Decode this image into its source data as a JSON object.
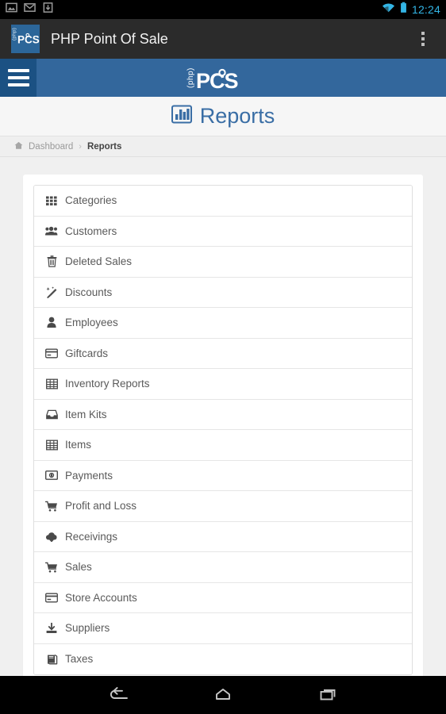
{
  "statusbar": {
    "icons": [
      "gallery-icon",
      "gmail-icon",
      "download-icon"
    ],
    "wifi_icon": "wifi-icon",
    "battery_icon": "battery-icon",
    "clock": "12:24",
    "accent_color": "#33b5e5"
  },
  "appbar": {
    "logo_text": "PCS",
    "logo_sub": "php",
    "title": "PHP Point Of Sale",
    "overflow_label": "More options",
    "background": "#2b2b2b",
    "logo_background": "#2c6699"
  },
  "navbar": {
    "menu_label": "Menu",
    "logo_main": "PCS",
    "logo_prefix": "(php)",
    "background": "#33679c",
    "menu_background": "#1b5183"
  },
  "page": {
    "title": "Reports",
    "title_icon": "bar-chart-icon",
    "title_color": "#3a6ea5"
  },
  "breadcrumb": {
    "home_icon": "home-icon",
    "items": [
      {
        "label": "Dashboard",
        "current": false
      },
      {
        "label": "Reports",
        "current": true
      }
    ],
    "separator": "›"
  },
  "reports": {
    "items": [
      {
        "label": "Categories",
        "icon": "grid-icon"
      },
      {
        "label": "Customers",
        "icon": "users-icon"
      },
      {
        "label": "Deleted Sales",
        "icon": "trash-icon"
      },
      {
        "label": "Discounts",
        "icon": "magic-wand-icon"
      },
      {
        "label": "Employees",
        "icon": "user-icon"
      },
      {
        "label": "Giftcards",
        "icon": "credit-card-icon"
      },
      {
        "label": "Inventory Reports",
        "icon": "table-icon"
      },
      {
        "label": "Item Kits",
        "icon": "inbox-icon"
      },
      {
        "label": "Items",
        "icon": "table-icon"
      },
      {
        "label": "Payments",
        "icon": "money-bill-icon"
      },
      {
        "label": "Profit and Loss",
        "icon": "shopping-cart-icon"
      },
      {
        "label": "Receivings",
        "icon": "cloud-download-icon"
      },
      {
        "label": "Sales",
        "icon": "shopping-cart-icon"
      },
      {
        "label": "Store Accounts",
        "icon": "credit-card-icon"
      },
      {
        "label": "Suppliers",
        "icon": "download-tray-icon"
      },
      {
        "label": "Taxes",
        "icon": "book-icon"
      }
    ]
  },
  "sysnav": {
    "back_label": "Back",
    "home_label": "Home",
    "recents_label": "Recent apps"
  }
}
